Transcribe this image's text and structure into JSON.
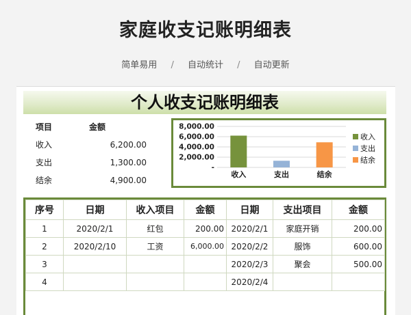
{
  "header": {
    "title": "家庭收支记账明细表",
    "features": [
      "简单易用",
      "自动统计",
      "自动更新"
    ],
    "separator": "/"
  },
  "sheet": {
    "title": "个人收支记账明细表",
    "summary": {
      "headers": [
        "项目",
        "金额"
      ],
      "rows": [
        {
          "label": "收入",
          "value": "6,200.00"
        },
        {
          "label": "支出",
          "value": "1,300.00"
        },
        {
          "label": "结余",
          "value": "4,900.00"
        }
      ]
    },
    "chart_data": {
      "type": "bar",
      "categories": [
        "收入",
        "支出",
        "结余"
      ],
      "values": [
        6200,
        1300,
        4900
      ],
      "colors": [
        "#76923c",
        "#95b3d7",
        "#f79646"
      ],
      "ylim": [
        0,
        8000
      ],
      "yticks": [
        "8,000.00",
        "6,000.00",
        "4,000.00",
        "2,000.00",
        "-"
      ],
      "ytick_values": [
        8000,
        6000,
        4000,
        2000,
        0
      ],
      "grid": true,
      "legend_position": "right",
      "legend": [
        "收入",
        "支出",
        "结余"
      ]
    },
    "ledger": {
      "headers": [
        "序号",
        "日期",
        "收入项目",
        "金额",
        "日期",
        "支出项目",
        "金额"
      ],
      "rows": [
        [
          "1",
          "2020/2/1",
          "红包",
          "200.00",
          "2020/2/1",
          "家庭开销",
          "200.00"
        ],
        [
          "2",
          "2020/2/10",
          "工资",
          "6,000.00",
          "2020/2/2",
          "服饰",
          "600.00"
        ],
        [
          "3",
          "",
          "",
          "",
          "2020/2/3",
          "聚会",
          "500.00"
        ],
        [
          "4",
          "",
          "",
          "",
          "2020/2/4",
          "",
          ""
        ]
      ]
    }
  }
}
